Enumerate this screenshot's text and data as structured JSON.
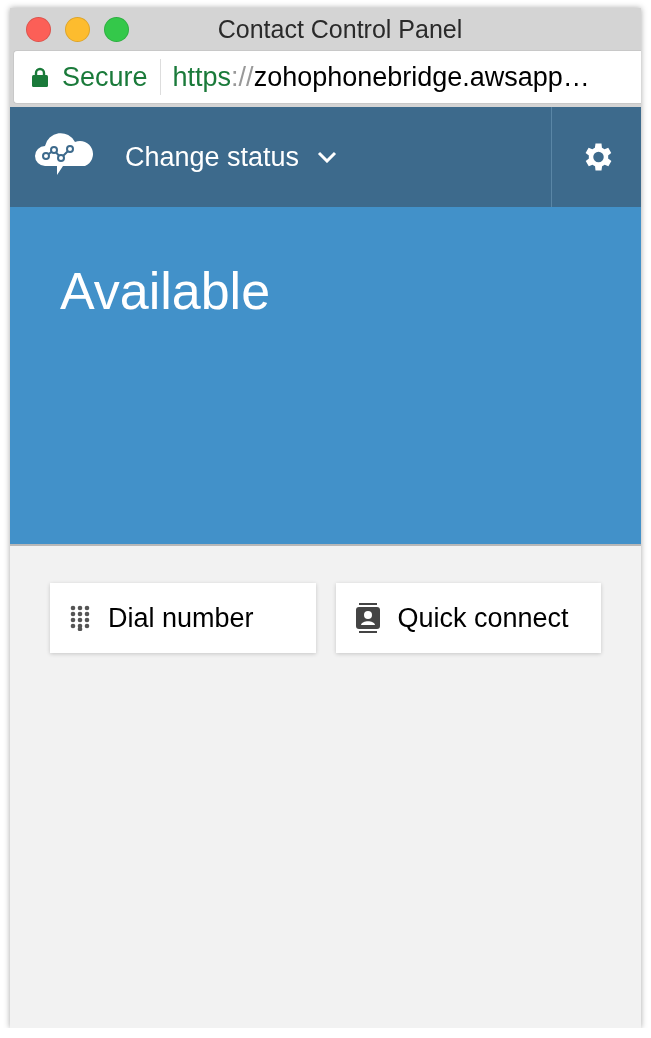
{
  "window": {
    "title": "Contact Control Panel"
  },
  "address_bar": {
    "security": "Secure",
    "scheme": "https",
    "separator": "://",
    "host": "zohophonebridge.awsapp…"
  },
  "header": {
    "status_menu": "Change status"
  },
  "status": {
    "label": "Available"
  },
  "actions": [
    {
      "kind": "dialpad",
      "label": "Dial number"
    },
    {
      "kind": "contacts",
      "label": "Quick connect"
    }
  ]
}
